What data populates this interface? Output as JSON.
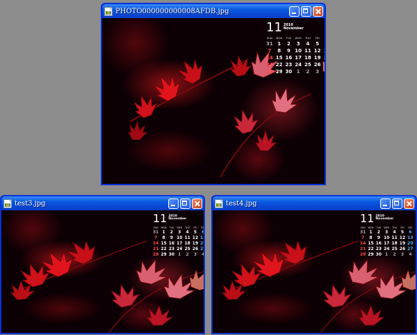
{
  "windows": [
    {
      "id": "w1",
      "title": "PHOTO000000000008AFDB.jpg"
    },
    {
      "id": "w2",
      "title": "test3.jpg"
    },
    {
      "id": "w3",
      "title": "test4.jpg"
    }
  ],
  "calendar": {
    "month_number": "11",
    "month_year_abbrev": "2010",
    "month_name": "November",
    "weekday_headers": [
      "SUN",
      "MON",
      "TUE",
      "WED",
      "THU",
      "FRI",
      "SAT"
    ],
    "weeks": [
      [
        "31",
        "1",
        "2",
        "3",
        "4",
        "5",
        "6"
      ],
      [
        "7",
        "8",
        "9",
        "10",
        "11",
        "12",
        "13"
      ],
      [
        "14",
        "15",
        "16",
        "17",
        "18",
        "19",
        "20"
      ],
      [
        "21",
        "22",
        "23",
        "24",
        "25",
        "26",
        "27"
      ],
      [
        "28",
        "29",
        "30",
        "1",
        "2",
        "3",
        "4"
      ]
    ]
  },
  "colors": {
    "desktop": "#8c8c8c",
    "titlebar": "#0a49d4",
    "sunday": "#ff4b4b",
    "saturday": "#4db1ff"
  },
  "icons": [
    "image-file-icon",
    "minimize-icon",
    "maximize-icon",
    "close-icon"
  ]
}
